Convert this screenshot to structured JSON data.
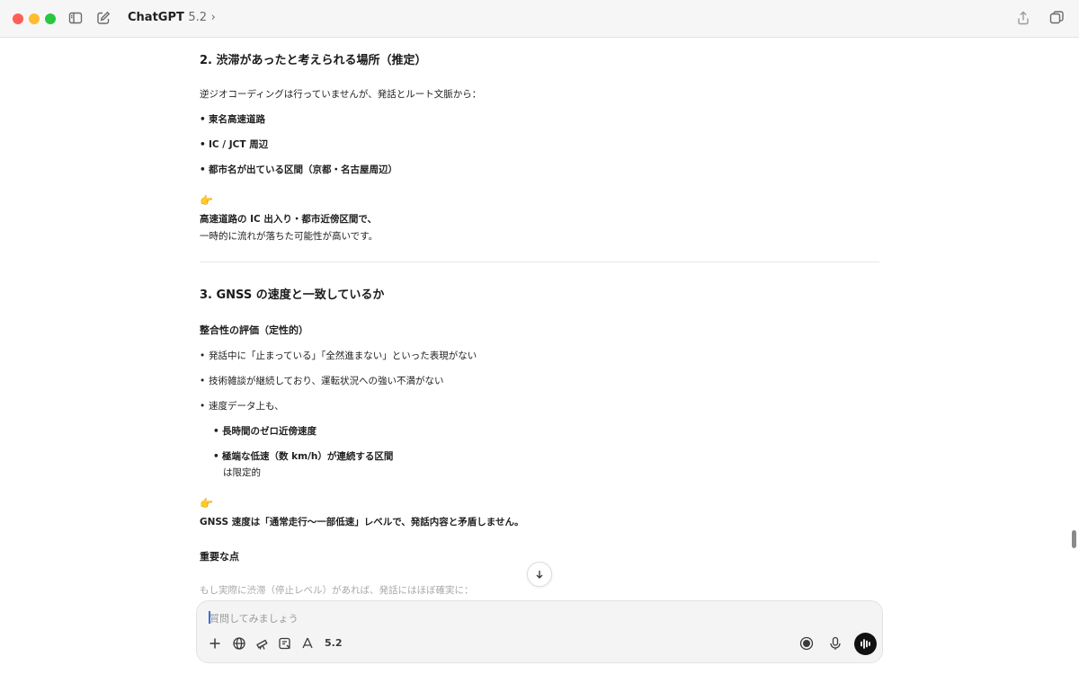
{
  "window": {
    "title": "ChatGPT",
    "version": "5.2",
    "chevron": "›"
  },
  "message": {
    "section2": {
      "heading": "2. 渋滞があったと考えられる場所（推定）",
      "intro": "逆ジオコーディングは行っていませんが、発話とルート文脈から：",
      "bullets": [
        "東名高速道路",
        "IC / JCT 周辺",
        "都市名が出ている区間（京都・名古屋周辺）"
      ],
      "emoji": "👉",
      "conclusion_line1": "高速道路の IC 出入り・都市近傍区間で、",
      "conclusion_line2": "一時的に流れが落ちた可能性が高いです。"
    },
    "section3": {
      "heading": "3. GNSS の速度と一致しているか",
      "subheading": "整合性の評価（定性的）",
      "bullets": [
        "発話中に「止まっている」「全然進まない」といった表現がない",
        "技術雑談が継続しており、運転状況への強い不満がない",
        "速度データ上も、"
      ],
      "subbullets": [
        "長時間のゼロ近傍速度",
        "極端な低速（数 km/h）が連続する区間"
      ],
      "subbullet_tail": "は限定的",
      "emoji": "👉",
      "conclusion": "GNSS 速度は「通常走行〜一部低速」レベルで、発話内容と矛盾しません。",
      "important_heading": "重要な点",
      "faded_line": "もし実際に渋滞（停止レベル）があれば、発話にはほぼ確実に："
    }
  },
  "composer": {
    "placeholder": "質問してみましょう",
    "model_label": "5.2"
  },
  "icons": {
    "sidebar": "sidebar-toggle-icon",
    "new_chat": "compose-icon",
    "share": "share-icon",
    "window": "new-window-icon",
    "scroll_down": "arrow-down-icon",
    "plus": "plus-icon",
    "globe": "globe-icon",
    "telescope": "telescope-icon",
    "canvas": "canvas-icon",
    "apps": "apps-icon",
    "record": "record-icon",
    "mic": "microphone-icon",
    "voice": "voice-mode-icon"
  }
}
